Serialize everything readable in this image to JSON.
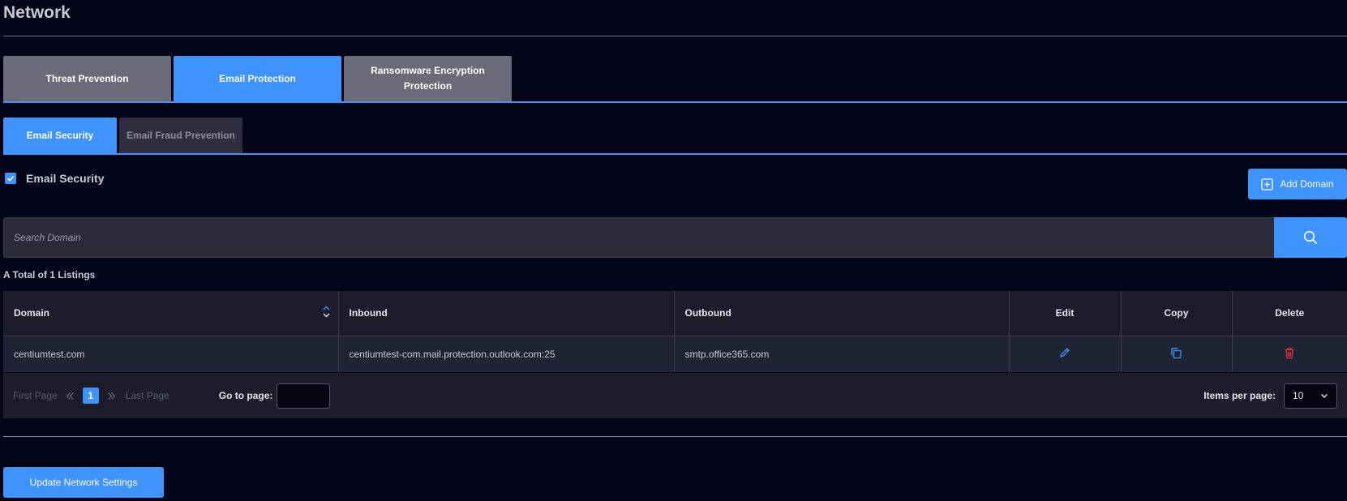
{
  "page": {
    "title": "Network"
  },
  "main_tabs": [
    {
      "label": "Threat Prevention",
      "active": false
    },
    {
      "label": "Email Protection",
      "active": true
    },
    {
      "label": "Ransomware Encryption Protection",
      "active": false
    }
  ],
  "sub_tabs": [
    {
      "label": "Email Security",
      "active": true
    },
    {
      "label": "Email Fraud Prevention",
      "active": false
    }
  ],
  "email_security": {
    "label": "Email Security",
    "checked": true
  },
  "add_domain": {
    "label": "Add Domain",
    "icon": "plus-square-icon"
  },
  "search": {
    "placeholder": "Search Domain",
    "value": "",
    "icon": "search-icon"
  },
  "listing": {
    "total_text": "A Total of 1 Listings"
  },
  "table": {
    "columns": [
      "Domain",
      "Inbound",
      "Outbound",
      "Edit",
      "Copy",
      "Delete"
    ],
    "rows": [
      {
        "domain": "centiumtest.com",
        "inbound": "centiumtest-com.mail.protection.outlook.com:25",
        "outbound": "smtp.office365.com",
        "edit_icon": "pencil-icon",
        "copy_icon": "copy-icon",
        "delete_icon": "trash-icon"
      }
    ]
  },
  "pagination": {
    "first_label": "First Page",
    "current_page": "1",
    "last_label": "Last Page",
    "goto_label": "Go to page:",
    "goto_value": "",
    "items_label": "Items per page:",
    "items_value": "10"
  },
  "update_button": {
    "label": "Update Network Settings"
  },
  "colors": {
    "accent": "#3f93fd",
    "background": "#05051a",
    "delete": "#e2333c"
  }
}
